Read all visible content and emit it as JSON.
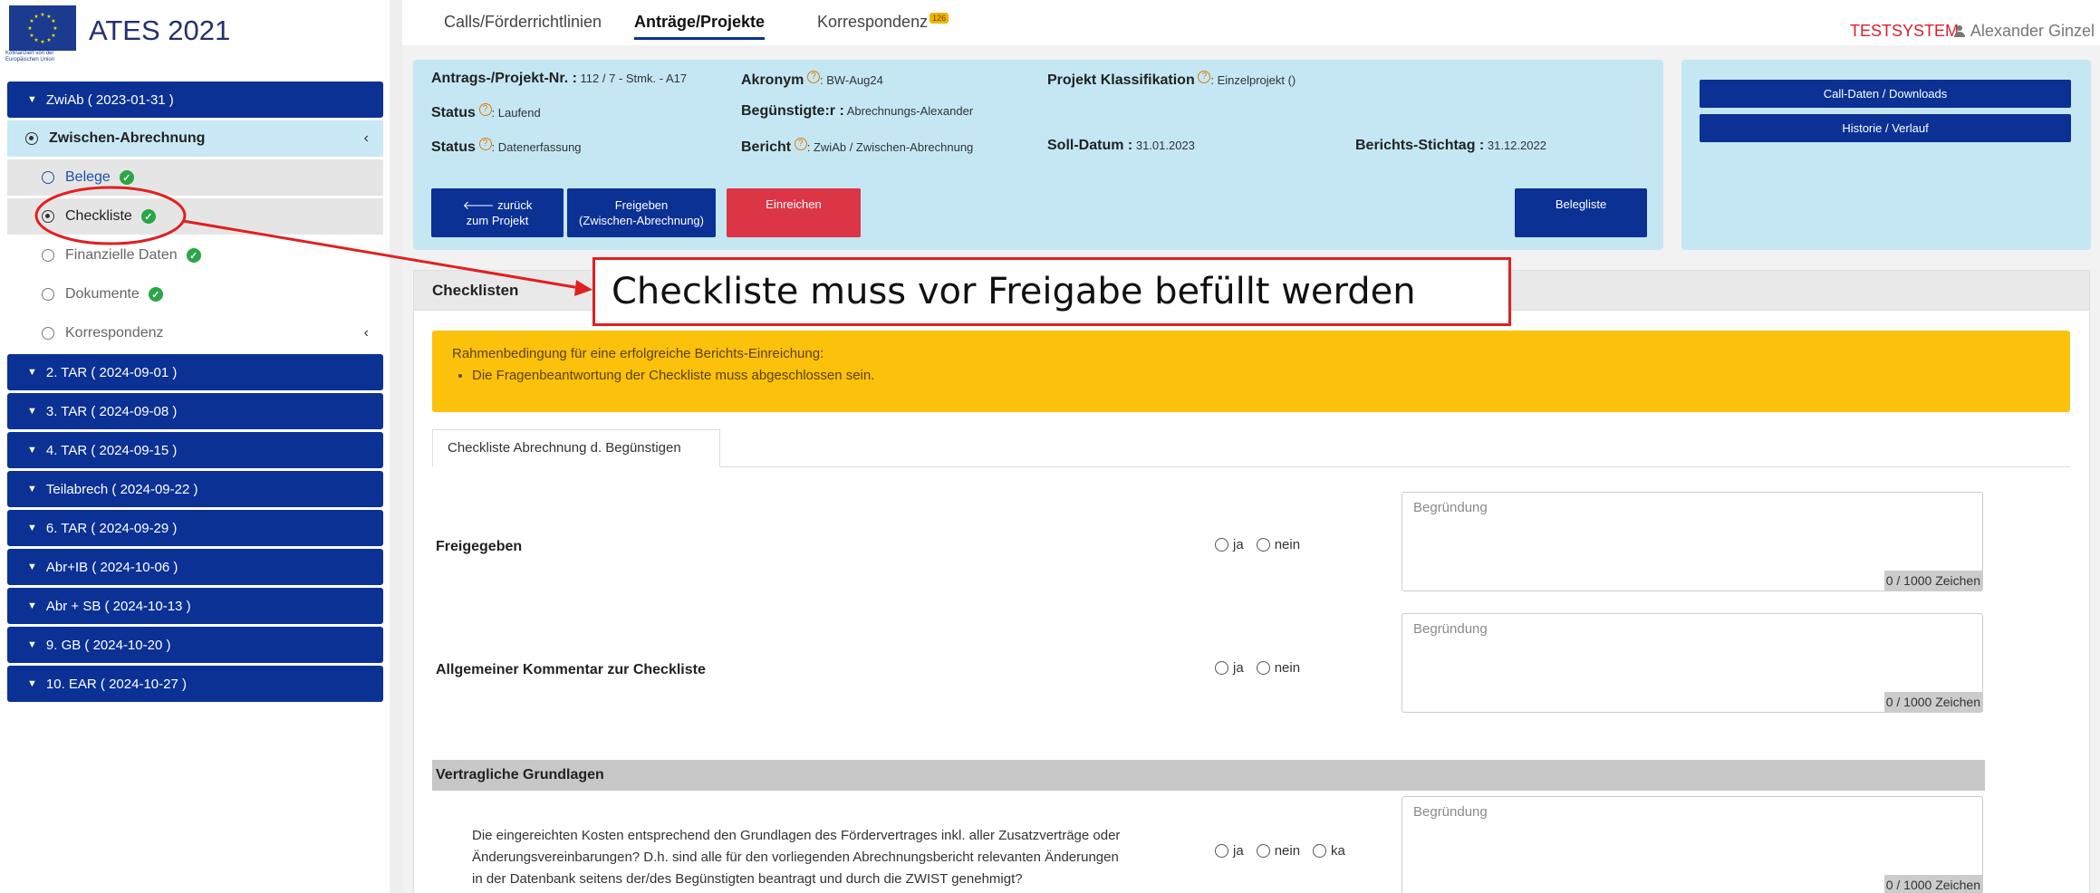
{
  "app": {
    "title": "ATES 2021",
    "eu_caption": "Kofinanziert von der Europäischen Union"
  },
  "topnav": {
    "tabs": [
      {
        "label": "Calls/Förderrichtlinien"
      },
      {
        "label": "Anträge/Projekte"
      },
      {
        "label": "Korrespondenz"
      }
    ],
    "korr_badge": "126",
    "env_label": "TESTSYSTEM",
    "user_name": "Alexander Ginzel"
  },
  "sidebar": {
    "groups_top": [
      {
        "label": "ZwiAb ( 2023-01-31 )"
      }
    ],
    "parent": {
      "label": "Zwischen-Abrechnung"
    },
    "children": [
      {
        "label": "Belege",
        "done": true
      },
      {
        "label": "Checkliste",
        "done": true
      },
      {
        "label": "Finanzielle Daten",
        "done": true
      },
      {
        "label": "Dokumente",
        "done": true
      },
      {
        "label": "Korrespondenz",
        "done": false
      }
    ],
    "groups": [
      {
        "label": "2. TAR ( 2024-09-01 )"
      },
      {
        "label": "3. TAR ( 2024-09-08 )"
      },
      {
        "label": "4. TAR ( 2024-09-15 )"
      },
      {
        "label": "Teilabrech ( 2024-09-22 )"
      },
      {
        "label": "6. TAR ( 2024-09-29 )"
      },
      {
        "label": "Abr+IB ( 2024-10-06 )"
      },
      {
        "label": "Abr + SB ( 2024-10-13 )"
      },
      {
        "label": "9. GB ( 2024-10-20 )"
      },
      {
        "label": "10. EAR ( 2024-10-27 )"
      }
    ]
  },
  "project": {
    "nr_label": "Antrags-/Projekt-Nr. :",
    "nr_value": "112 / 7 - Stmk. - A17",
    "akronym_label": "Akronym",
    "akronym_value": ": BW-Aug24",
    "klass_label": "Projekt Klassifikation",
    "klass_value": ": Einzelprojekt ()",
    "status1_label": "Status",
    "status1_value": ": Laufend",
    "beg_label": "Begünstigte:r :",
    "beg_value": "Abrechnungs-Alexander",
    "status2_label": "Status",
    "status2_value": ": Datenerfassung",
    "bericht_label": "Bericht",
    "bericht_value": ": ZwiAb / Zwischen-Abrechnung",
    "soll_label": "Soll-Datum :",
    "soll_value": "31.01.2023",
    "stichtag_label": "Berichts-Stichtag :",
    "stichtag_value": "31.12.2022"
  },
  "buttons": {
    "back_line1": "zurück",
    "back_line2": "zum Projekt",
    "freigeben_line1": "Freigeben",
    "freigeben_line2": "(Zwischen-Abrechnung)",
    "einreichen": "Einreichen",
    "belegliste": "Belegliste",
    "call_daten": "Call-Daten / Downloads",
    "historie": "Historie / Verlauf"
  },
  "checklist": {
    "header": "Checklisten",
    "alert_title": "Rahmenbedingung für eine erfolgreiche Berichts-Einreichung:",
    "alert_item": "Die Fragenbeantwortung der Checkliste muss abgeschlossen sein.",
    "subtab": "Checkliste Abrechnung d. Begünstigen",
    "q1": "Freigegeben",
    "q2": "Allgemeiner Kommentar zur Checkliste",
    "opt_ja": "ja",
    "opt_nein": "nein",
    "opt_ka": "ka",
    "textarea_placeholder": "Begründung",
    "char_count": "0 / 1000 Zeichen",
    "section": "Vertragliche Grundlagen",
    "q3_line1": "Die eingereichten Kosten entsprechend den Grundlagen des Fördervertrages inkl. aller Zusatzverträge oder",
    "q3_line2": "Änderungsvereinbarungen? D.h. sind alle für den vorliegenden Abrechnungsbericht relevanten Änderungen",
    "q3_line3": "in der Datenbank seitens der/des Begünstigten beantragt und durch die ZWIST genehmigt?"
  },
  "annotation": {
    "text": "Checkliste muss vor Freigabe befüllt werden",
    "color": "#e02020"
  },
  "colors": {
    "primary": "#0b3195",
    "panel": "#c5e7f4",
    "danger": "#dc3545",
    "warning": "#fcc10b",
    "success": "#28a745"
  }
}
